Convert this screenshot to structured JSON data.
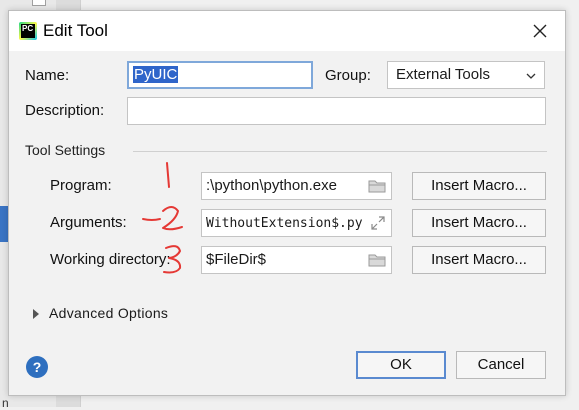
{
  "window": {
    "title": "Edit Tool",
    "app_icon_text": "PC"
  },
  "form": {
    "name_label": "Name:",
    "name_value": "PyUIC",
    "group_label": "Group:",
    "group_value": "External Tools",
    "description_label": "Description:",
    "description_value": ""
  },
  "tool_settings": {
    "section_title": "Tool Settings",
    "program_label": "Program:",
    "program_value": ":\\python\\python.exe",
    "arguments_label": "Arguments:",
    "arguments_value": "WithoutExtension$.py",
    "working_dir_label": "Working directory:",
    "working_dir_value": "$FileDir$",
    "insert_macro_label": "Insert Macro..."
  },
  "advanced": {
    "label": "Advanced Options"
  },
  "buttons": {
    "ok": "OK",
    "cancel": "Cancel",
    "help": "?"
  },
  "annotations": [
    "1",
    "2",
    "3"
  ],
  "background": {
    "bottom_fragment": "n"
  },
  "colors": {
    "selection": "#2f65ca",
    "focus_border": "#7fa8da",
    "help": "#2e6fbf",
    "annotation": "#e53935"
  }
}
